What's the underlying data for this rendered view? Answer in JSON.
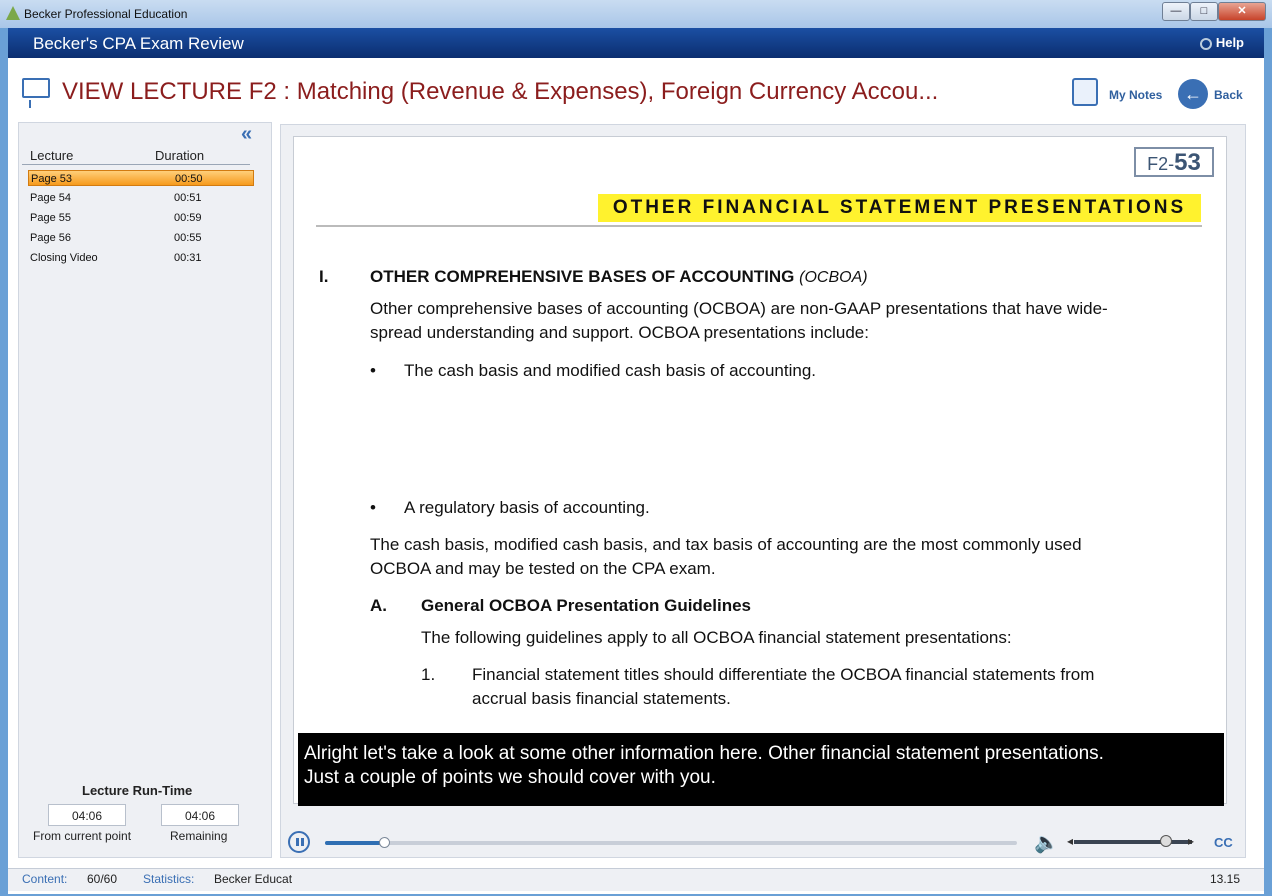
{
  "window": {
    "title": "Becker Professional Education",
    "minimize": "—",
    "maximize": "□",
    "close": "✕"
  },
  "brandbar": {
    "app_name": "Becker's CPA Exam Review",
    "help_label": "Help"
  },
  "header": {
    "title": "VIEW LECTURE  F2 : Matching (Revenue & Expenses), Foreign Currency Accou...",
    "notes_label": "My Notes",
    "back_label": "Back"
  },
  "sidebar": {
    "collapse_glyph": "«",
    "col_lecture": "Lecture",
    "col_duration": "Duration",
    "items": [
      {
        "name": "Page 53",
        "duration": "00:50",
        "selected": true
      },
      {
        "name": "Page 54",
        "duration": "00:51",
        "selected": false
      },
      {
        "name": "Page 55",
        "duration": "00:59",
        "selected": false
      },
      {
        "name": "Page 56",
        "duration": "00:55",
        "selected": false
      },
      {
        "name": "Closing Video",
        "duration": "00:31",
        "selected": false
      }
    ],
    "runtime": {
      "title": "Lecture Run-Time",
      "from_current": "04:06",
      "from_current_label": "From current point",
      "remaining": "04:06",
      "remaining_label": "Remaining"
    }
  },
  "slide": {
    "tag_prefix": "F2-",
    "tag_number": "53",
    "heading": "OTHER FINANCIAL STATEMENT PRESENTATIONS",
    "section_num": "I.",
    "section_title": "OTHER COMPREHENSIVE BASES OF ACCOUNTING",
    "section_title_abbr": "(OCBOA)",
    "intro_line1": "Other comprehensive bases of accounting (OCBOA) are non-GAAP presentations that have wide-",
    "intro_line2": "spread understanding and support.  OCBOA presentations include:",
    "bullet1": "The cash basis and modified cash basis of accounting.",
    "bullet2": "A regulatory basis of accounting.",
    "para2_line1": "The cash basis, modified cash basis, and tax basis of accounting are the most commonly used",
    "para2_line2": "OCBOA and may be tested on the CPA exam.",
    "sub_num": "A.",
    "sub_title": "General OCBOA Presentation Guidelines",
    "sub_intro": "The following guidelines apply to all OCBOA financial statement presentations:",
    "item1_num": "1.",
    "item1_line1": "Financial statement titles should differentiate the OCBOA financial statements from",
    "item1_line2": "accrual basis financial statements."
  },
  "caption": {
    "line1": "Alright let's take a look at some other information here.  Other financial statement presentations.",
    "line2": "Just a couple of points we should cover with you."
  },
  "player": {
    "progress": 0.085,
    "volume": 0.78,
    "cc_label": "CC"
  },
  "statusbar": {
    "content_label": "Content:",
    "content_value": "60/60",
    "statistics_label": "Statistics:",
    "statistics_value": "Becker Educat",
    "version": "13.15"
  },
  "colors": {
    "accent": "#3a6fb4",
    "title_red": "#8b1d1d",
    "selected_row": "#f69a1c",
    "highlight_yellow": "#fff22e"
  }
}
